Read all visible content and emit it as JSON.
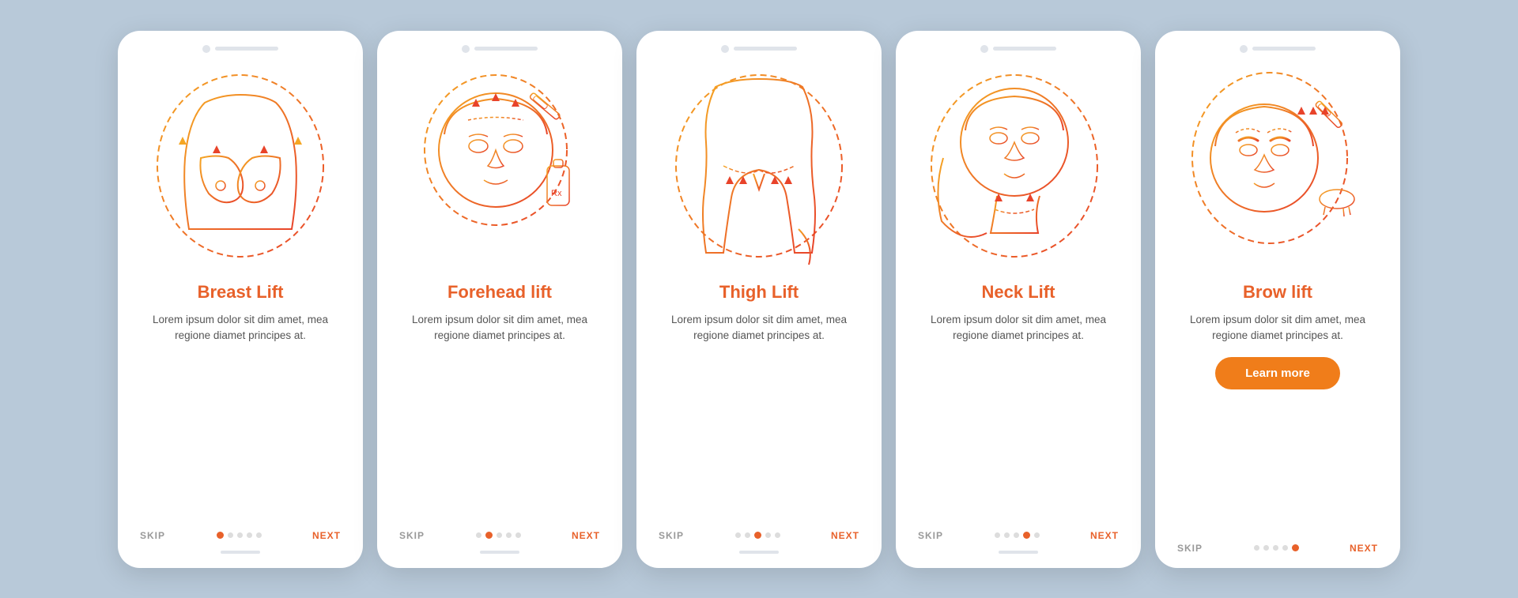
{
  "cards": [
    {
      "id": "breast-lift",
      "title": "Breast Lift",
      "description": "Lorem ipsum dolor sit dim amet, mea regione diamet principes at.",
      "activeDot": 0,
      "showLearnMore": false,
      "dots": 5
    },
    {
      "id": "forehead-lift",
      "title": "Forehead lift",
      "description": "Lorem ipsum dolor sit dim amet, mea regione diamet principes at.",
      "activeDot": 1,
      "showLearnMore": false,
      "dots": 5
    },
    {
      "id": "thigh-lift",
      "title": "Thigh Lift",
      "description": "Lorem ipsum dolor sit dim amet, mea regione diamet principes at.",
      "activeDot": 2,
      "showLearnMore": false,
      "dots": 5
    },
    {
      "id": "neck-lift",
      "title": "Neck Lift",
      "description": "Lorem ipsum dolor sit dim amet, mea regione diamet principes at.",
      "activeDot": 3,
      "showLearnMore": false,
      "dots": 5
    },
    {
      "id": "brow-lift",
      "title": "Brow lift",
      "description": "Lorem ipsum dolor sit dim amet, mea regione diamet principes at.",
      "activeDot": 4,
      "showLearnMore": true,
      "learnMoreLabel": "Learn more",
      "dots": 5
    }
  ],
  "nav": {
    "skip": "SKIP",
    "next": "NEXT"
  }
}
